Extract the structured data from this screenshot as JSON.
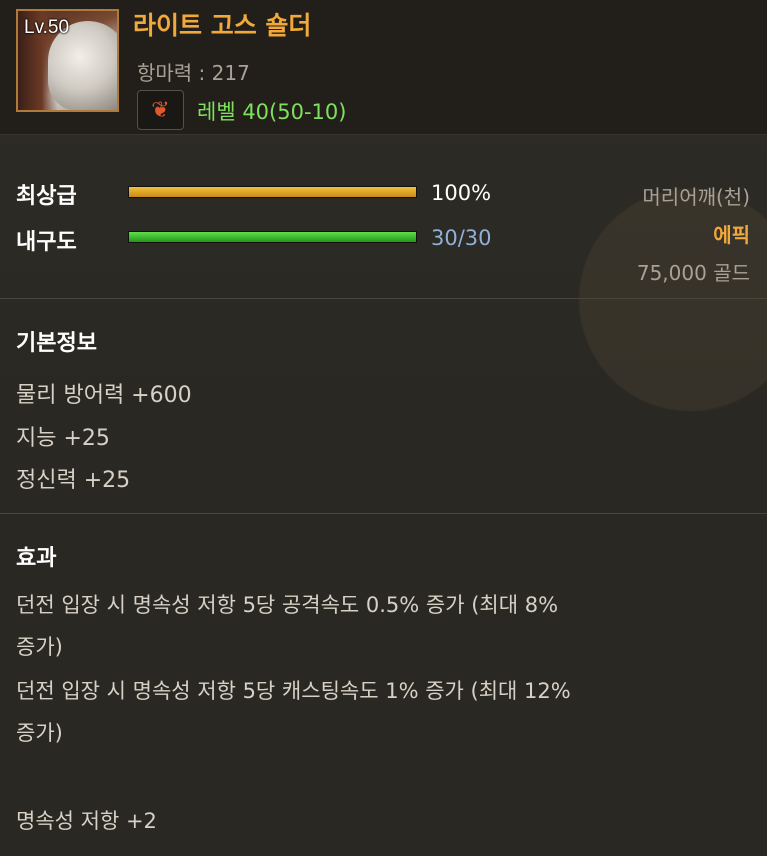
{
  "item": {
    "level_badge": "Lv.50",
    "name": "라이트 고스 숄더",
    "magic_resist": "항마력 : 217",
    "level_requirement": "레벨 40(50-10)"
  },
  "stats_bars": {
    "grade_label": "최상급",
    "grade_value": "100%",
    "grade_fill": 1.0,
    "durability_label": "내구도",
    "durability_value": "30/30",
    "durability_fill": 1.0
  },
  "meta": {
    "slot": "머리어깨(천)",
    "rarity": "에픽",
    "price": "75,000 골드"
  },
  "basic_info": {
    "title": "기본정보",
    "lines": [
      "물리 방어력 +600",
      "지능 +25",
      "정신력 +25"
    ]
  },
  "effects": {
    "title": "효과",
    "line1a": "던전 입장 시 명속성 저항 5당 공격속도 0.5% 증가 (최대 8%",
    "line1b": "증가)",
    "line2a": "던전 입장 시 명속성 저항 5당 캐스팅속도 1% 증가 (최대 12%",
    "line2b": "증가)",
    "line3": "명속성 저항 +2"
  },
  "colors": {
    "title_orange": "#f0a93a",
    "rarity_orange": "#f0a93a",
    "level_green": "#7ee05c",
    "grade_bar": "#e3a925",
    "durability_bar": "#3fbf2f",
    "durability_text": "#8fb0d8"
  },
  "icons": {
    "item_icon": "shoulder-armor-icon",
    "class_icon": "phoenix-feather-icon"
  }
}
